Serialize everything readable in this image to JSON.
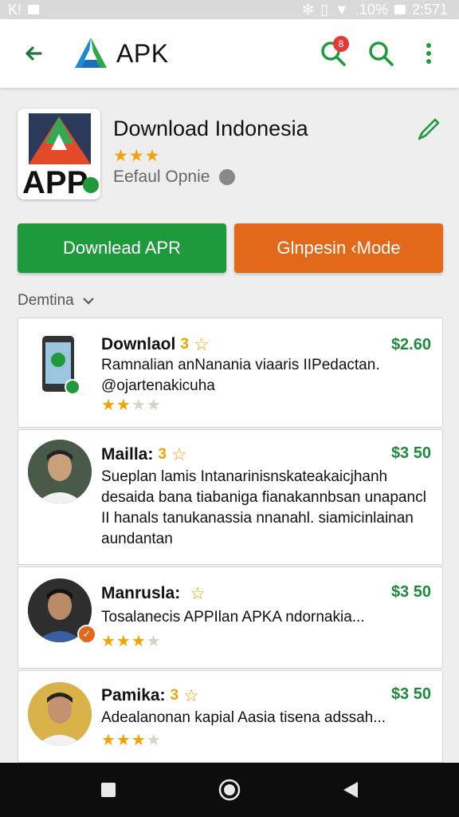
{
  "status_bar": {
    "left": "K!",
    "battery": ".10%",
    "time": "2:571"
  },
  "app_bar": {
    "title": "APK",
    "notification_count": "8"
  },
  "app_header": {
    "name": "Download Indonesia",
    "stars": "★★★",
    "subtitle": "Eefaul Opnie"
  },
  "actions": {
    "download_label": "Downlead APR",
    "open_label": "Glnpesin ‹Mode"
  },
  "filter": {
    "label": "Demtina"
  },
  "reviews": [
    {
      "name": "Downlaol",
      "num": "3",
      "price": "$2.60",
      "desc": "Ramnalian anNanania viaaris IIPedactan. @ojartenakicuha",
      "rating_on": "★★",
      "rating_off": "★★"
    },
    {
      "name": "Mailla:",
      "num": "3",
      "price": "$3 50",
      "desc": "Sueplan lamis Intanarinisnskateakaicjhanh desaida bana tiabaniga fianakannbsan unapancl II hanals tanukanassia nnanahl. siamicinlainan aundantan",
      "rating_on": "",
      "rating_off": ""
    },
    {
      "name": "Manrusla:",
      "num": "",
      "price": "$3 50",
      "desc": "Tosalanecis APPIlan APKA ndornakia...",
      "rating_on": "★★★",
      "rating_off": "★"
    },
    {
      "name": "Pamika:",
      "num": "3",
      "price": "$3 50",
      "desc": "Adealanonan kapial Aasia tisena adssah...",
      "rating_on": "★★★",
      "rating_off": "★"
    }
  ],
  "colors": {
    "brand_green": "#1e9a3c",
    "accent_orange": "#e2681a",
    "star": "#f2a300"
  },
  "icons": [
    "back-arrow-icon",
    "apk-logo-icon",
    "notification-search-icon",
    "search-icon",
    "more-vert-icon",
    "edit-icon",
    "square-nav-icon",
    "home-nav-icon",
    "back-nav-icon"
  ]
}
